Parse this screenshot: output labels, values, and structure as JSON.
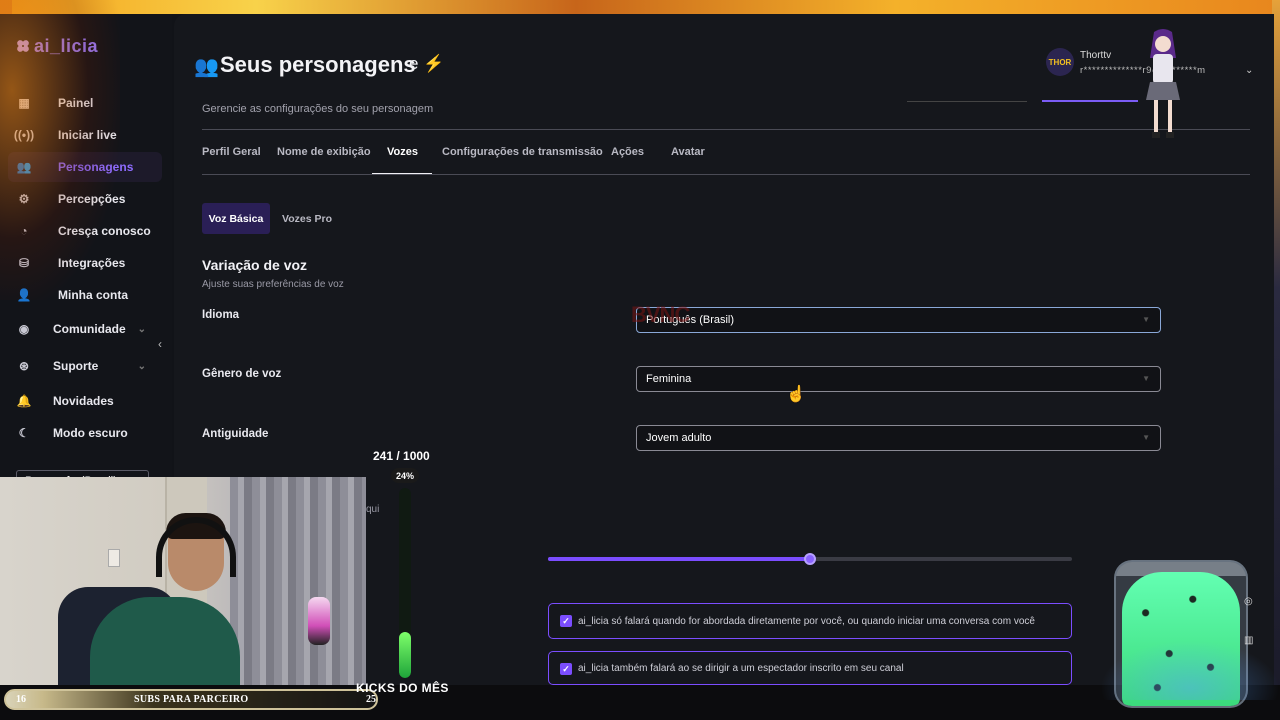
{
  "app": {
    "logo_text": "ai_licia"
  },
  "sidebar": {
    "items": [
      {
        "label": "Painel",
        "icon": "grid-icon"
      },
      {
        "label": "Iniciar live",
        "icon": "broadcast-icon"
      },
      {
        "label": "Personagens",
        "icon": "users-icon",
        "active": true
      },
      {
        "label": "Percepções",
        "icon": "perception-icon"
      },
      {
        "label": "Cresça conosco",
        "icon": "growth-icon"
      },
      {
        "label": "Integrações",
        "icon": "integrations-icon"
      },
      {
        "label": "Minha conta",
        "icon": "user-icon"
      },
      {
        "label": "Comunidade",
        "icon": "community-icon"
      },
      {
        "label": "Suporte",
        "icon": "support-icon"
      },
      {
        "label": "Novidades",
        "icon": "bell-icon"
      },
      {
        "label": "Modo escuro",
        "icon": "moon-icon"
      }
    ],
    "language": "Português (Brasil)"
  },
  "header": {
    "title": "Seus personagens",
    "subtitle": "Gerencie as configurações do seu personagem",
    "user_name": "Thorttv",
    "user_email": "r**************r9@g*******m",
    "avatar_text": "THOR"
  },
  "tabs": [
    {
      "label": "Perfil Geral"
    },
    {
      "label": "Nome de exibição"
    },
    {
      "label": "Vozes",
      "active": true
    },
    {
      "label": "Configurações de transmissão"
    },
    {
      "label": "Ações"
    },
    {
      "label": "Avatar"
    }
  ],
  "subtabs": {
    "basic": "Voz Básica",
    "pro": "Vozes Pro"
  },
  "voice": {
    "section_title": "Variação de voz",
    "section_subtitle": "Ajuste suas preferências de voz",
    "fields": [
      {
        "label": "Idioma",
        "value": "Português (Brasil)"
      },
      {
        "label": "Gênero de voz",
        "value": "Feminina"
      },
      {
        "label": "Antiguidade",
        "value": "Jovem adulto"
      }
    ],
    "slider_fraction": 0.5,
    "partial_text": "qui"
  },
  "checkboxes": [
    {
      "label": "ai_licia só falará quando for abordada diretamente por você, ou quando iniciar uma conversa com você",
      "checked": true
    },
    {
      "label": "ai_licia também falará ao se dirigir a um espectador inscrito em seu canal",
      "checked": true
    }
  ],
  "overlay": {
    "meter_count": "241 / 1000",
    "meter_percent": "24%",
    "meter_fraction": 0.24,
    "subs_left": "16",
    "subs_text": "SUBS PARA PARCEIRO",
    "subs_right": "25",
    "kicks_label": "KICKS DO MÊS",
    "watermark": "BVNC"
  },
  "colors": {
    "accent": "#7b4dff",
    "active_nav": "#8e6cff",
    "background": "#15171c"
  }
}
